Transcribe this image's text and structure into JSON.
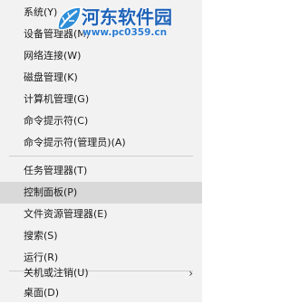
{
  "menu": {
    "items": [
      {
        "label": "系统(Y)"
      },
      {
        "label": "设备管理器(M)"
      },
      {
        "label": "网络连接(W)"
      },
      {
        "label": "磁盘管理(K)"
      },
      {
        "label": "计算机管理(G)"
      },
      {
        "label": "命令提示符(C)"
      },
      {
        "label": "命令提示符(管理员)(A)"
      },
      {
        "label": "任务管理器(T)"
      },
      {
        "label": "控制面板(P)"
      },
      {
        "label": "文件资源管理器(E)"
      },
      {
        "label": "搜索(S)"
      },
      {
        "label": "运行(R)"
      },
      {
        "label": "关机或注销(U)"
      },
      {
        "label": "桌面(D)"
      }
    ],
    "submenu_arrow": "›",
    "highlighted_item": "控制面板(P)"
  },
  "watermark": {
    "title": "河东软件园",
    "url": "www.pc0359.cn",
    "icon": "leaf-logo-icon",
    "title_color": "#1f63b8",
    "url_color": "#2a7bd1"
  },
  "colors": {
    "menu_background": "#f2f2f2",
    "highlight_background": "#d9d9d9",
    "separator": "#cfcfcf"
  }
}
